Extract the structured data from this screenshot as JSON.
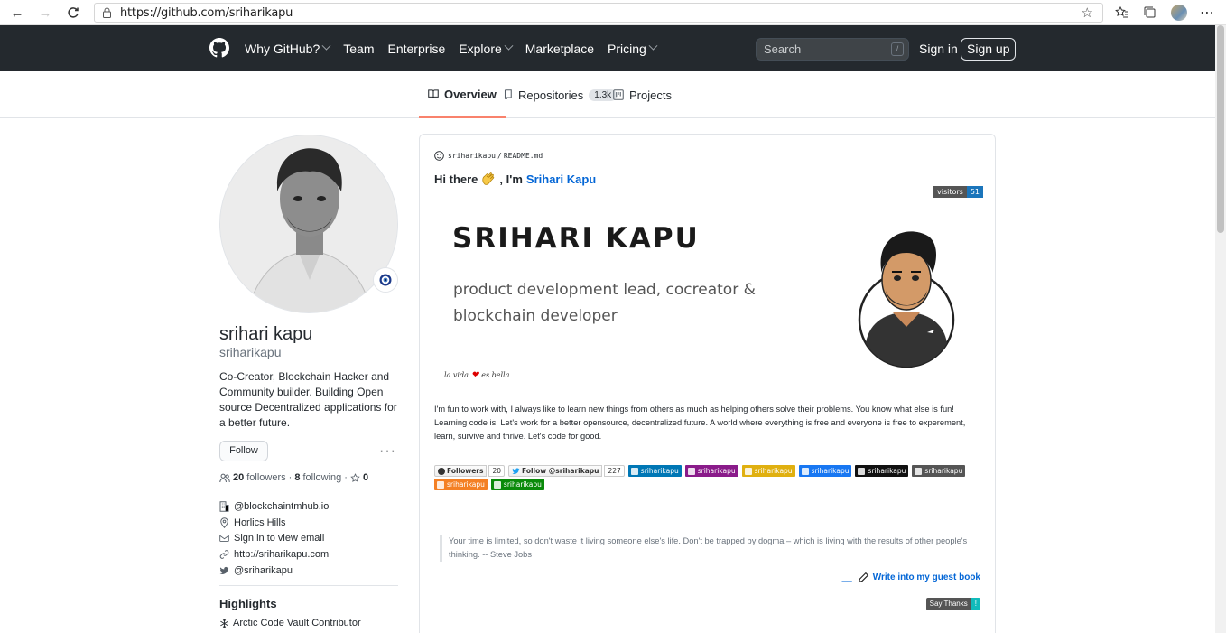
{
  "browser": {
    "url": "https://github.com/sriharikapu"
  },
  "header": {
    "nav": [
      "Why GitHub?",
      "Team",
      "Enterprise",
      "Explore",
      "Marketplace",
      "Pricing"
    ],
    "search_placeholder": "Search",
    "search_key": "/",
    "signin_label": "Sign in",
    "signup_label": "Sign up"
  },
  "tabs": [
    {
      "label": "Overview",
      "active": true
    },
    {
      "label": "Repositories",
      "count": "1.3k"
    },
    {
      "label": "Projects"
    }
  ],
  "profile": {
    "name": "srihari kapu",
    "login": "sriharikapu",
    "bio": "Co-Creator, Blockchain Hacker and Community builder. Building Open source Decentralized applications for a better future.",
    "follow_label": "Follow",
    "more_label": "···",
    "followers_count": "20",
    "followers_label": "followers",
    "following_count": "8",
    "following_label": "following",
    "stars_count": "0",
    "company": "@blockchaintmhub.io",
    "location": "Horlics Hills",
    "email": "Sign in to view email",
    "website": "http://sriharikapu.com",
    "twitter": "@sriharikapu",
    "highlights_title": "Highlights",
    "highlight_item": "Arctic Code Vault Contributor"
  },
  "readme": {
    "path_user": "sriharikapu",
    "path_sep": "/",
    "path_file": "README.md",
    "hi_prefix": "Hi there",
    "hi_middle": ", I'm",
    "hi_name": "Srihari Kapu",
    "visitors_label": "visitors",
    "visitors_count": "51",
    "banner_name": "SRIHARI KAPU",
    "banner_role": "product development lead, cocreator & blockchain developer",
    "motto_left": "la vida",
    "motto_right": "es bella",
    "about": "I'm fun to work with, I always like to learn new things from others as much as helping others solve their problems. You know what else is fun! Learning code is. Let's work for a better opensource, decentralized future. A world where everything is free and everyone is free to experement, learn, survive and thrive. Let's code for good.",
    "badges": {
      "followers_label": "Followers",
      "followers_count": "20",
      "twitter_label": "Follow @sriharikapu",
      "twitter_count": "227",
      "linkedin": "sriharikapu",
      "instagram": "sriharikapu",
      "angellist": "sriharikapu",
      "facebook": "sriharikapu",
      "medium": "sriharikapu",
      "telegram": "sriharikapu",
      "stackoverflow": "sriharikapu",
      "codementor": "sriharikapu"
    },
    "quote": "Your time is limited, so don't waste it living someone else's life. Don't be trapped by dogma – which is living with the results of other people's thinking. -- Steve Jobs",
    "guestbook_dash": "__",
    "guestbook_label": "Write into my guest book",
    "saythanks_label": "Say Thanks",
    "saythanks_mark": "!"
  },
  "colors": {
    "header_bg": "#24292e",
    "link": "#0366d6",
    "active_tab": "#f9826c",
    "linkedin": "#0077b5",
    "instagram": "#8a1b8a",
    "angellist": "#e0b010",
    "facebook": "#1877f2",
    "medium": "#111111",
    "telegram": "#555555",
    "stackoverflow": "#f48024",
    "codementor": "#0a8a0a"
  }
}
